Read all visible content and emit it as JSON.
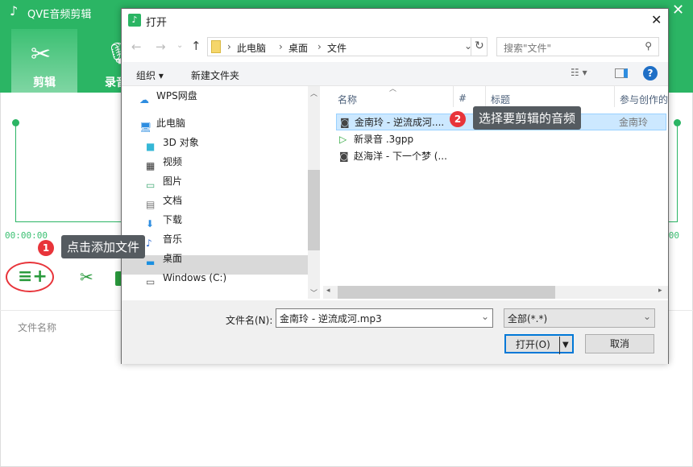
{
  "app": {
    "title": "QVE音频剪辑",
    "tabs": [
      {
        "label": "剪辑",
        "icon": "scissors-icon",
        "active": true
      },
      {
        "label": "录音",
        "icon": "microphone-icon"
      }
    ],
    "accent": "#2bb564",
    "time_start": "00:00:00",
    "time_end": "00:00:00",
    "file_name_header": "文件名称"
  },
  "tips": [
    {
      "number": "1",
      "text": "点击添加文件"
    },
    {
      "number": "2",
      "text": "选择要剪辑的音频"
    }
  ],
  "dialog": {
    "title": "打开",
    "breadcrumb": [
      "此电脑",
      "桌面",
      "文件"
    ],
    "search_placeholder": "搜索\"文件\"",
    "toolbar": {
      "organize": "组织",
      "new_folder": "新建文件夹"
    },
    "nav": [
      {
        "label": "WPS网盘",
        "icon": "cloud-icon"
      },
      {
        "label": "此电脑",
        "icon": "computer-icon"
      },
      {
        "label": "3D 对象",
        "icon": "cube-icon"
      },
      {
        "label": "视频",
        "icon": "film-icon"
      },
      {
        "label": "图片",
        "icon": "picture-icon"
      },
      {
        "label": "文档",
        "icon": "document-icon"
      },
      {
        "label": "下载",
        "icon": "download-icon"
      },
      {
        "label": "音乐",
        "icon": "music-icon"
      },
      {
        "label": "桌面",
        "icon": "desktop-icon",
        "selected": true
      },
      {
        "label": "Windows (C:)",
        "icon": "drive-icon"
      }
    ],
    "columns": [
      "名称",
      "#",
      "标题",
      "参与创作的艺术家"
    ],
    "files": [
      {
        "name": "金南玲 - 逆流成河....",
        "artist": "金南玲",
        "selected": true,
        "icon": "audio-file-icon"
      },
      {
        "name": "新录音 .3gpp",
        "artist": "",
        "icon": "media-file-icon"
      },
      {
        "name": "赵海洋 - 下一个梦 (...",
        "artist": "",
        "icon": "audio-file-icon"
      }
    ],
    "filename_label": "文件名(N):",
    "filename_value": "金南玲 - 逆流成河.mp3",
    "filter": "全部(*.*)",
    "open": "打开(O)",
    "cancel": "取消"
  }
}
